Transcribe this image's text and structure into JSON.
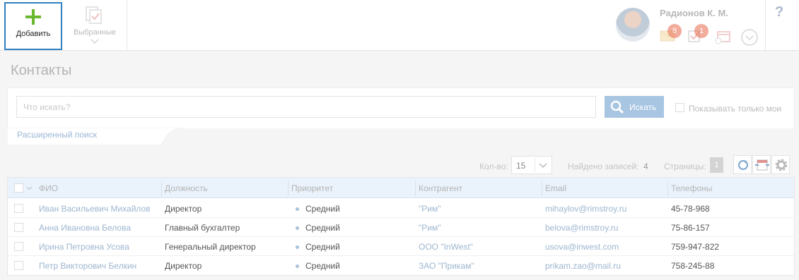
{
  "toolbar": {
    "add_label": "Добавить",
    "favorites_label": "Выбранные"
  },
  "user": {
    "name": "Радионов К. М.",
    "mail_count": "8",
    "task_count": "1"
  },
  "help_label": "?",
  "page_title": "Контакты",
  "search": {
    "placeholder": "Что искать?",
    "button_label": "Искать",
    "only_mine_label": "Показывать только мои",
    "advanced_link": "Расширенный поиск"
  },
  "list_toolbar": {
    "qty_label": "Кол-во:",
    "qty_value": "15",
    "found_label": "Найдено записей:",
    "found_value": "4",
    "pages_label": "Страницы:",
    "page_current": "1"
  },
  "table": {
    "columns": [
      "ФИО",
      "Должность",
      "Приоритет",
      "Контрагент",
      "Email",
      "Телефоны"
    ],
    "rows": [
      {
        "name": "Иван Васильевич Михайлов",
        "position": "Директор",
        "priority": "Средний",
        "counterparty": "\"Рим\"",
        "email": "mihaylov@rimstroy.ru",
        "phone": "45-78-968"
      },
      {
        "name": "Анна Ивановна Белова",
        "position": "Главный бухгалтер",
        "priority": "Средний",
        "counterparty": "\"Рим\"",
        "email": "belova@rimstroy.ru",
        "phone": "75-86-157"
      },
      {
        "name": "Ирина Петровна Усова",
        "position": "Генеральный директор",
        "priority": "Средний",
        "counterparty": "ООО \"InWest\"",
        "email": "usova@inwest.com",
        "phone": "759-947-822"
      },
      {
        "name": "Петр Викторович Белкин",
        "position": "Директор",
        "priority": "Средний",
        "counterparty": "ЗАО \"Прикам\"",
        "email": "prikam.zao@mail.ru",
        "phone": "758-245-88"
      }
    ]
  },
  "colors": {
    "accent_blue": "#2f7fc1",
    "add_green": "#6ab82f",
    "badge_red": "#e86a4c",
    "header_bg": "#eaf2fb"
  }
}
